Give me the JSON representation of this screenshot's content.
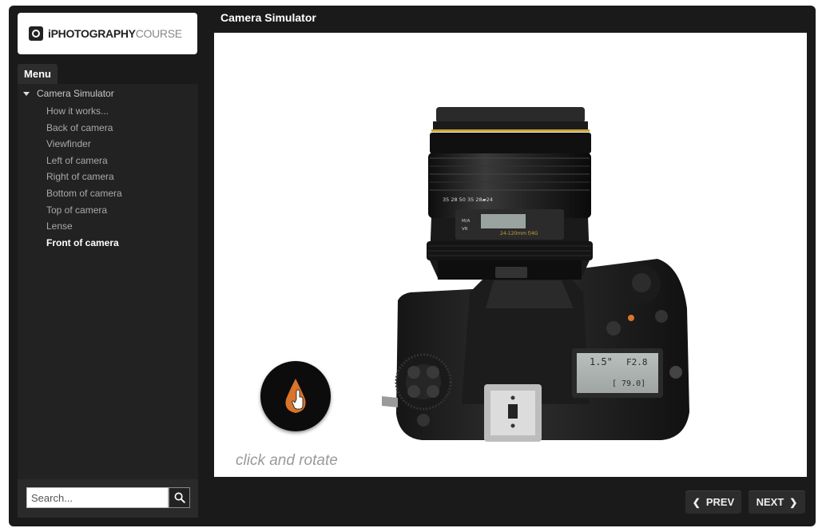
{
  "logo": {
    "bold_text": "iPHOTOGRAPHY",
    "light_text": "COURSE"
  },
  "menu": {
    "tab_label": "Menu",
    "parent_label": "Camera Simulator",
    "items": [
      {
        "label": "How it works...",
        "active": false
      },
      {
        "label": "Back of camera",
        "active": false
      },
      {
        "label": "Viewfinder",
        "active": false
      },
      {
        "label": "Left of camera",
        "active": false
      },
      {
        "label": "Right of camera",
        "active": false
      },
      {
        "label": "Bottom of camera",
        "active": false
      },
      {
        "label": "Top of camera",
        "active": false
      },
      {
        "label": "Lense",
        "active": false
      },
      {
        "label": "Front of camera",
        "active": true
      }
    ]
  },
  "search": {
    "placeholder": "Search...",
    "icon": "search-icon"
  },
  "content": {
    "title": "Camera Simulator",
    "caption": "click and rotate",
    "lens": {
      "scale": "35    28    50    35  28▰24",
      "model": "24-120mm f/4G",
      "switch_a": "M/A",
      "switch_b": "VR"
    },
    "lcd": {
      "shutter": "1.5\"",
      "aperture": "F2.8",
      "exposure": "[ 79.0]"
    }
  },
  "nav": {
    "prev_label": "PREV",
    "next_label": "NEXT"
  },
  "colors": {
    "frame": "#1a1a1a",
    "accent_orange": "#d9742a",
    "lens_gold": "#c9a233"
  }
}
